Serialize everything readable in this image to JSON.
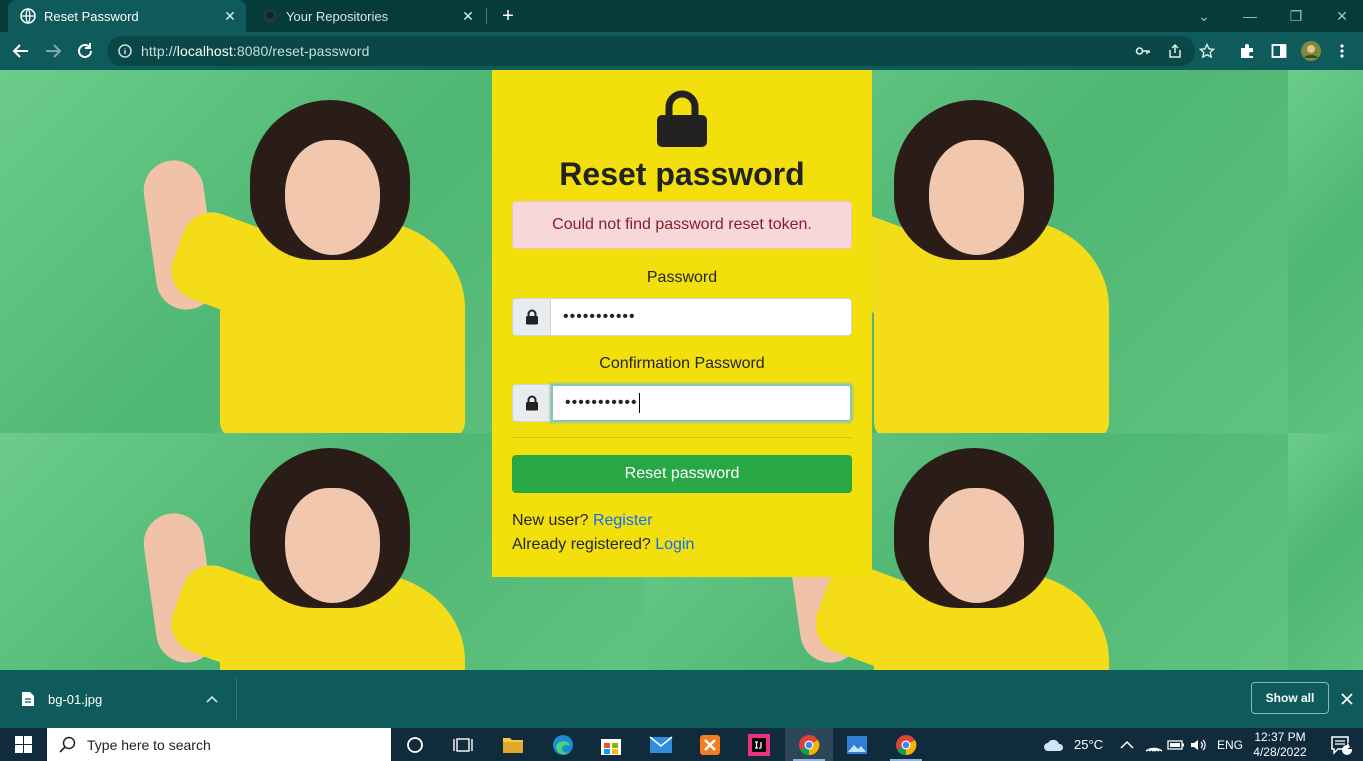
{
  "browser": {
    "tabs": [
      {
        "title": "Reset Password",
        "active": true
      },
      {
        "title": "Your Repositories",
        "active": false
      }
    ],
    "url_prefix": "http://",
    "url_host": "localhost",
    "url_rest": ":8080/reset-password"
  },
  "form": {
    "heading": "Reset password",
    "alert": "Could not find password reset token.",
    "password_label": "Password",
    "password_value": "•••••••••••",
    "confirm_label": "Confirmation Password",
    "confirm_value": "•••••••••••",
    "submit_label": "Reset password",
    "new_user_text": "New user?",
    "register_link": "Register",
    "already_text": "Already registered?",
    "login_link": "Login"
  },
  "downloads": {
    "file_name": "bg-01.jpg",
    "show_all": "Show all"
  },
  "taskbar": {
    "search_placeholder": "Type here to search",
    "weather": "25°C",
    "language": "ENG",
    "time": "12:37 PM",
    "date": "4/28/2022",
    "notification_count": "1"
  },
  "colors": {
    "card": "#f3df0c",
    "page_bg": "#5bbf7c",
    "submit": "#28a745",
    "alert_bg": "#f8d7da",
    "alert_text": "#842029",
    "link": "#0d6efd",
    "browser_chrome": "#0f5a5a"
  }
}
